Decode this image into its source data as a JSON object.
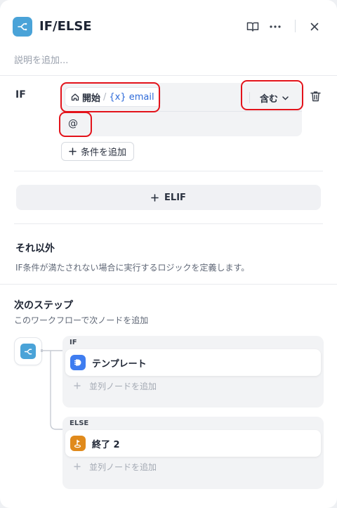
{
  "header": {
    "title": "IF/ELSE",
    "description_placeholder": "説明を追加..."
  },
  "if_section": {
    "label": "IF",
    "condition": {
      "source_node": "開始",
      "separator": "/",
      "variable": "{x} email",
      "operator": "含む",
      "value": "@"
    },
    "add_condition_label": "条件を追加"
  },
  "elif_button_label": "ELIF",
  "else_section": {
    "title": "それ以外",
    "description": "IF条件が満たされない場合に実行するロジックを定義します。"
  },
  "next_step": {
    "title": "次のステップ",
    "description": "このワークフローで次ノードを追加",
    "branches": [
      {
        "label": "IF",
        "node": "テンプレート",
        "add_parallel": "並列ノードを追加"
      },
      {
        "label": "ELSE",
        "node": "終了 2",
        "add_parallel": "並列ノードを追加"
      }
    ]
  },
  "colors": {
    "accent_blue": "#4aa3d8",
    "highlight_red": "#e3131b",
    "template_icon": "#3f7df0",
    "end_icon": "#e08a1c",
    "variable_text": "#2f6bd9"
  }
}
